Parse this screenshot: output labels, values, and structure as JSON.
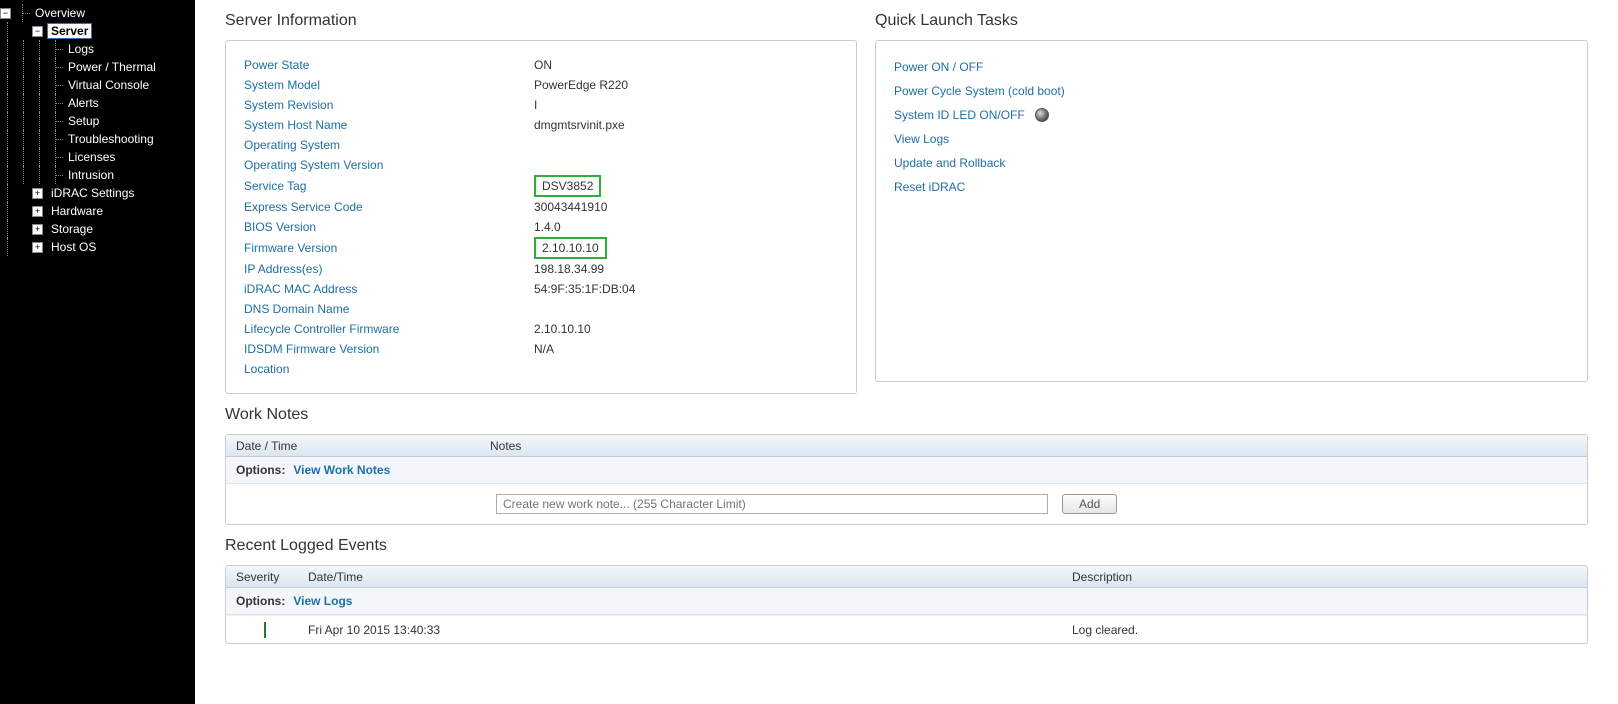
{
  "sidebar": {
    "overview": "Overview",
    "server": "Server",
    "server_children": [
      "Logs",
      "Power / Thermal",
      "Virtual Console",
      "Alerts",
      "Setup",
      "Troubleshooting",
      "Licenses",
      "Intrusion"
    ],
    "others": [
      "iDRAC Settings",
      "Hardware",
      "Storage",
      "Host OS"
    ]
  },
  "server_info": {
    "title": "Server Information",
    "rows": [
      {
        "label": "Power State",
        "value": "ON"
      },
      {
        "label": "System Model",
        "value": "PowerEdge R220"
      },
      {
        "label": "System Revision",
        "value": "I"
      },
      {
        "label": "System Host Name",
        "value": "dmgmtsrvinit.pxe"
      },
      {
        "label": "Operating System",
        "value": ""
      },
      {
        "label": "Operating System Version",
        "value": ""
      },
      {
        "label": "Service Tag",
        "value": "DSV3852",
        "highlight": true
      },
      {
        "label": "Express Service Code",
        "value": "30043441910"
      },
      {
        "label": "BIOS Version",
        "value": "1.4.0"
      },
      {
        "label": "Firmware Version",
        "value": "2.10.10.10",
        "highlight": true
      },
      {
        "label": "IP Address(es)",
        "value": "198.18.34.99"
      },
      {
        "label": "iDRAC MAC Address",
        "value": "54:9F:35:1F:DB:04"
      },
      {
        "label": "DNS Domain Name",
        "value": ""
      },
      {
        "label": "Lifecycle Controller Firmware",
        "value": "2.10.10.10"
      },
      {
        "label": "IDSDM Firmware Version",
        "value": "N/A"
      },
      {
        "label": "Location",
        "value": ""
      }
    ]
  },
  "quick_launch": {
    "title": "Quick Launch Tasks",
    "links": [
      "Power ON / OFF",
      "Power Cycle System (cold boot)",
      "System ID LED ON/OFF",
      "View Logs",
      "Update and Rollback",
      "Reset iDRAC"
    ]
  },
  "work_notes": {
    "title": "Work Notes",
    "col_date": "Date / Time",
    "col_notes": "Notes",
    "options_label": "Options:",
    "view_link": "View Work Notes",
    "placeholder": "Create new work note... (255 Character Limit)",
    "add_label": "Add"
  },
  "events": {
    "title": "Recent Logged Events",
    "col_sev": "Severity",
    "col_dt": "Date/Time",
    "col_desc": "Description",
    "options_label": "Options:",
    "view_link": "View Logs",
    "rows": [
      {
        "severity": "ok",
        "datetime": "Fri Apr 10 2015 13:40:33",
        "description": "Log cleared."
      }
    ]
  }
}
